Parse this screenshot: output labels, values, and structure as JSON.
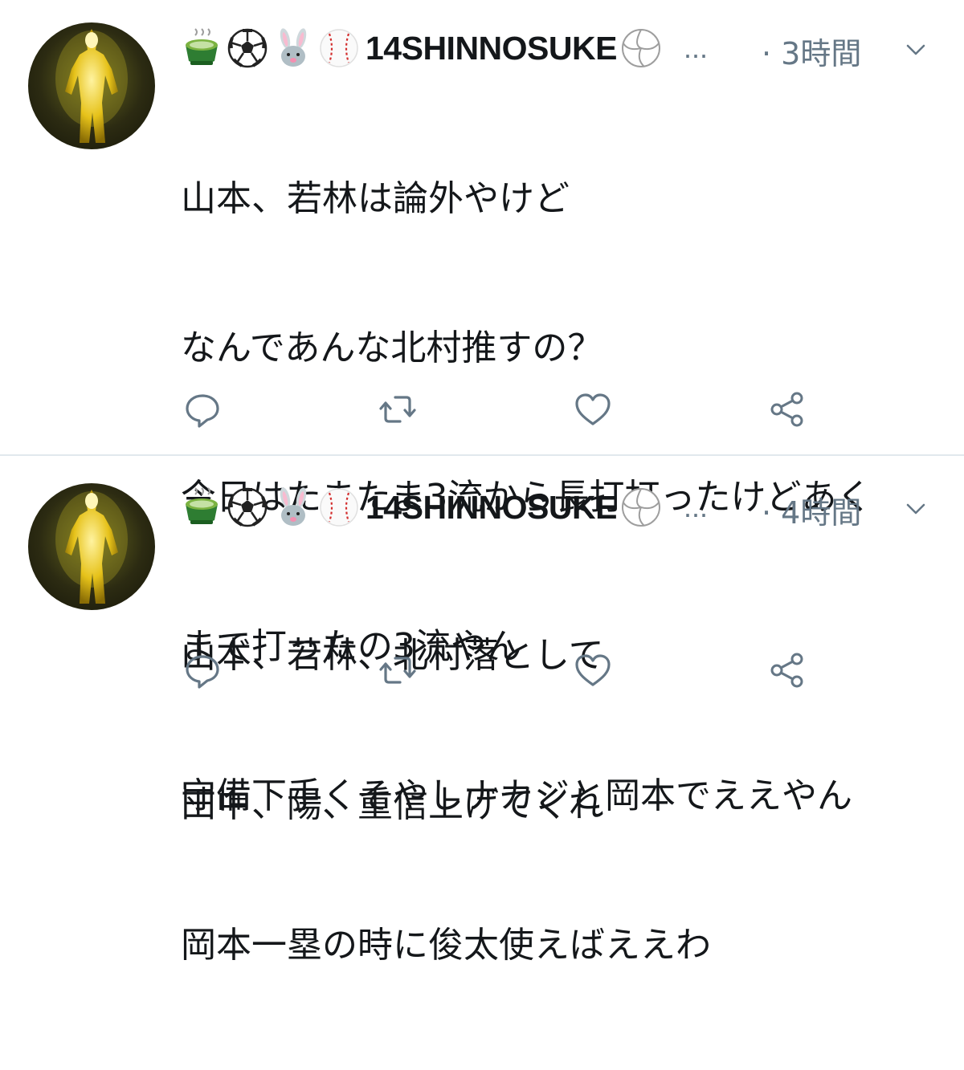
{
  "colors": {
    "text": "#14171a",
    "secondary": "#657786",
    "divider": "#e1e8ed",
    "background": "#ffffff"
  },
  "tweets": [
    {
      "display_name": "14SHINNOSUKE",
      "name_emojis_before": [
        "matcha-icon",
        "soccer-ball-icon",
        "rabbit-icon",
        "baseball-icon"
      ],
      "name_emoji_after": "volleyball-icon",
      "truncation": "...",
      "time": "· 3時間",
      "lines": [
        "山本、若林は論外やけど",
        "なんであんな北村推すの？",
        "今日はたまたま3流から長打打ったけどあく",
        "まで打ったの3流やん",
        "守備下手くそやしナカジと岡本でええやん",
        "岡本一塁の時に俊太使えばええわ"
      ],
      "actions": [
        "reply-icon",
        "retweet-icon",
        "like-icon",
        "share-icon"
      ]
    },
    {
      "display_name": "14SHINNOSUKE",
      "name_emojis_before": [
        "matcha-icon",
        "soccer-ball-icon",
        "rabbit-icon",
        "baseball-icon"
      ],
      "name_emoji_after": "volleyball-icon",
      "truncation": "...",
      "time": "· 4時間",
      "lines": [
        "山本、若林、北村落として",
        "田中、陽、重信上げてくれ"
      ],
      "actions": [
        "reply-icon",
        "retweet-icon",
        "like-icon",
        "share-icon"
      ]
    }
  ]
}
